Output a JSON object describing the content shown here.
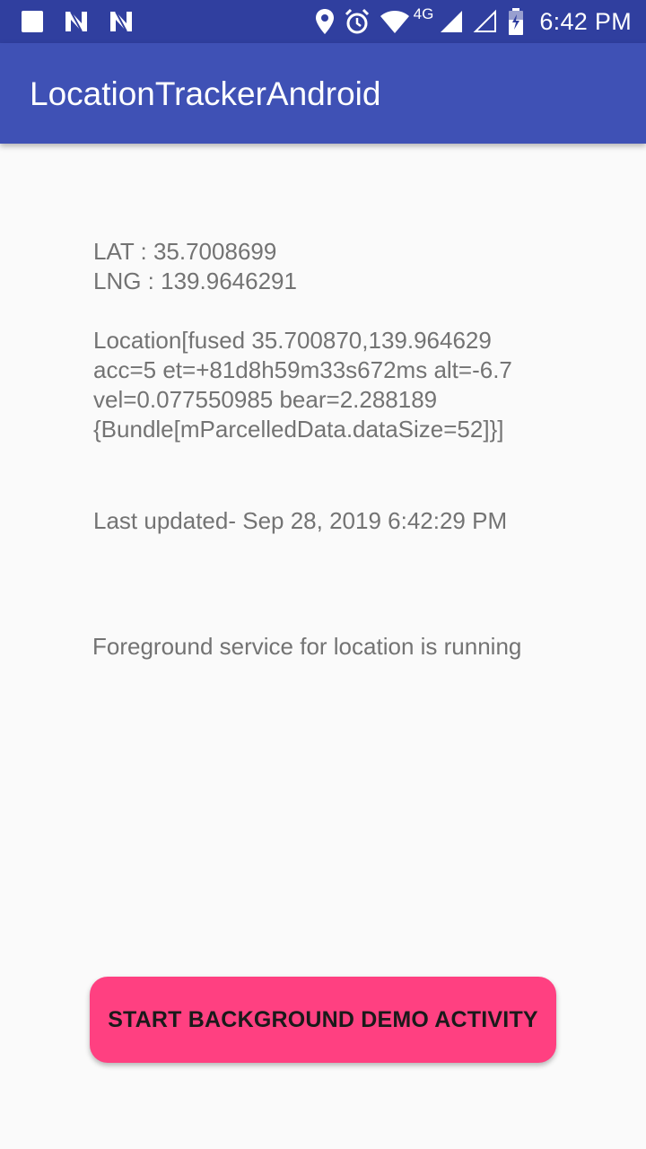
{
  "status_bar": {
    "time": "6:42 PM",
    "network_label": "4G",
    "icons": [
      "square-notification-icon",
      "n-notification-icon",
      "n-notification-icon",
      "location-pin-icon",
      "alarm-icon",
      "wifi-icon",
      "signal-icon",
      "signal-empty-icon",
      "battery-icon"
    ]
  },
  "app_bar": {
    "title": "LocationTrackerAndroid"
  },
  "location": {
    "lat_line": "LAT :  35.7008699",
    "lng_line": "LNG : 139.9646291",
    "detail_lines": [
      "Location[fused 35.700870,139.964629",
      "acc=5 et=+81d8h59m33s672ms alt=-6.7",
      "vel=0.077550985 bear=2.288189",
      "{Bundle[mParcelledData.dataSize=52]}]"
    ]
  },
  "last_updated": "Last updated- Sep 28, 2019 6:42:29 PM",
  "service_status": "Foreground service for location is running",
  "button": {
    "label": "START BACKGROUND DEMO ACTIVITY"
  },
  "colors": {
    "status_bar": "#303f9f",
    "app_bar": "#3f51b5",
    "accent": "#ff4081",
    "text_secondary": "#737373",
    "background": "#fafafa"
  }
}
